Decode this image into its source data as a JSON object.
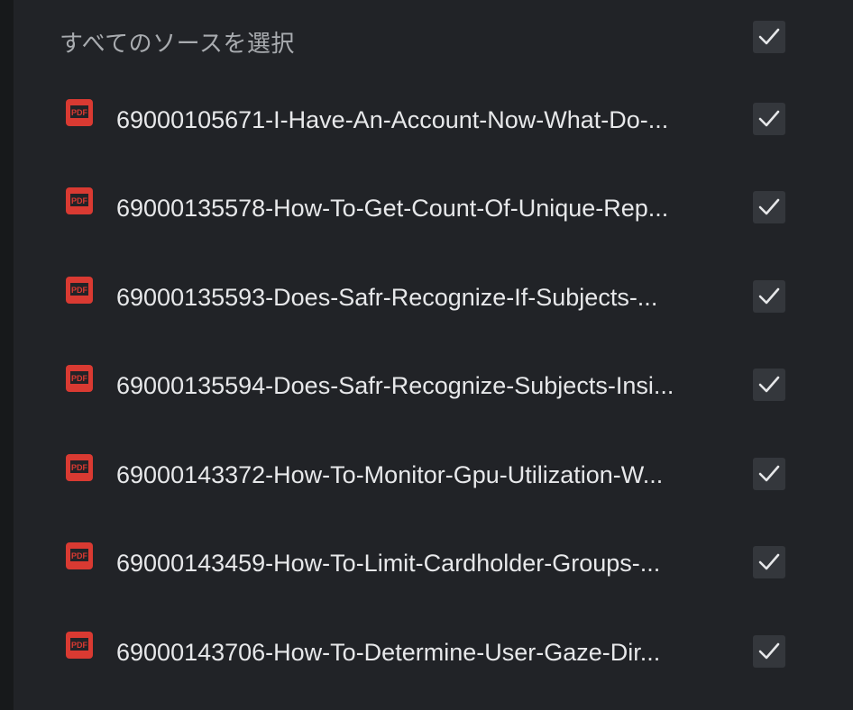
{
  "select_all": {
    "label": "すべてのソースを選択",
    "checked": true
  },
  "icons": {
    "file": "pdf-icon",
    "check": "checkmark-icon"
  },
  "colors": {
    "pdf_red": "#d93a32",
    "check": "#e6e7e9"
  },
  "sources": [
    {
      "title": "69000105671-I-Have-An-Account-Now-What-Do-...",
      "checked": true
    },
    {
      "title": "69000135578-How-To-Get-Count-Of-Unique-Rep...",
      "checked": true
    },
    {
      "title": "69000135593-Does-Safr-Recognize-If-Subjects-...",
      "checked": true
    },
    {
      "title": "69000135594-Does-Safr-Recognize-Subjects-Insi...",
      "checked": true
    },
    {
      "title": "69000143372-How-To-Monitor-Gpu-Utilization-W...",
      "checked": true
    },
    {
      "title": "69000143459-How-To-Limit-Cardholder-Groups-...",
      "checked": true
    },
    {
      "title": "69000143706-How-To-Determine-User-Gaze-Dir...",
      "checked": true
    }
  ]
}
